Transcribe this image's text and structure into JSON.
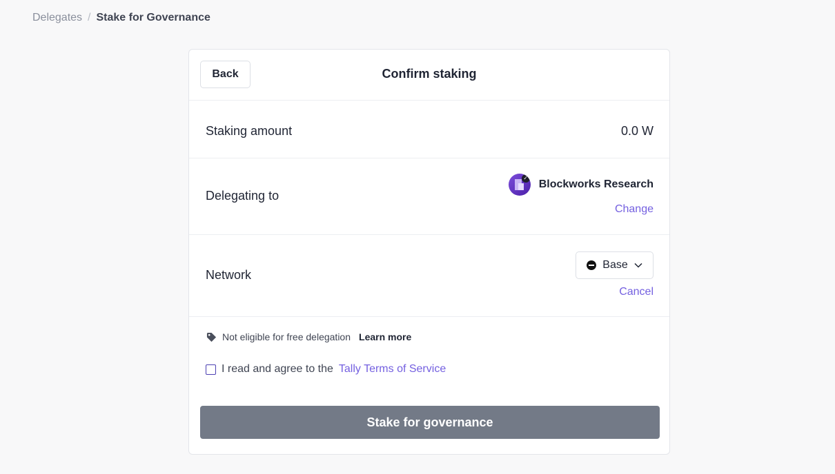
{
  "breadcrumb": {
    "parent": "Delegates",
    "separator": "/",
    "current": "Stake for Governance"
  },
  "card": {
    "back_label": "Back",
    "title": "Confirm staking",
    "staking_amount": {
      "label": "Staking amount",
      "value": "0.0 W"
    },
    "delegating": {
      "label": "Delegating to",
      "delegate_name": "Blockworks Research",
      "change_label": "Change"
    },
    "network": {
      "label": "Network",
      "selected": "Base",
      "cancel_label": "Cancel"
    },
    "eligibility": {
      "text": "Not eligible for free delegation",
      "learn_more": "Learn more"
    },
    "terms": {
      "prefix": "I read and agree to the",
      "link": "Tally Terms of Service",
      "checked": false
    },
    "submit_label": "Stake for governance"
  },
  "colors": {
    "accent": "#7460e0",
    "submit_disabled": "#737a87",
    "background": "#f8f8f9"
  },
  "icons": {
    "delegate_avatar": "blockworks-avatar",
    "twitter": "twitter-icon",
    "network": "base-network-icon",
    "dropdown": "chevron-down-icon",
    "eligibility": "tag-icon"
  }
}
